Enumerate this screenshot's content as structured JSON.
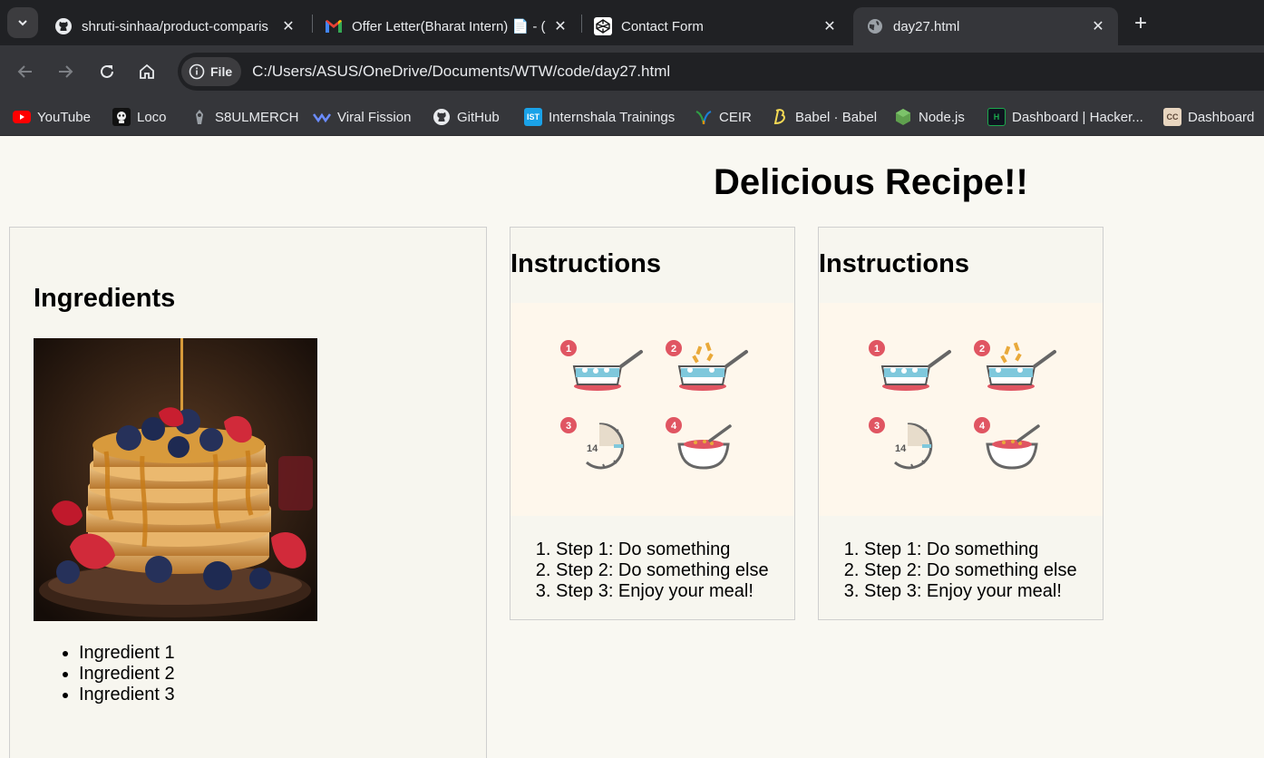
{
  "browser": {
    "tabs": [
      {
        "title": "shruti-sinhaa/product-comparis",
        "icon": "github-icon"
      },
      {
        "title": "Offer Letter(Bharat Intern) 📄 - (",
        "icon": "gmail-icon"
      },
      {
        "title": "Contact Form",
        "icon": "codepen-icon"
      },
      {
        "title": "day27.html",
        "icon": "globe-icon",
        "active": true
      }
    ],
    "address": {
      "chip_label": "File",
      "url": "C:/Users/ASUS/OneDrive/Documents/WTW/code/day27.html"
    },
    "bookmarks": [
      {
        "label": "YouTube",
        "icon": "youtube-icon"
      },
      {
        "label": "Loco",
        "icon": "loco-icon"
      },
      {
        "label": "S8ULMERCH",
        "icon": "s8ul-icon"
      },
      {
        "label": "Viral Fission",
        "icon": "viral-fission-icon"
      },
      {
        "label": "GitHub",
        "icon": "github-icon"
      },
      {
        "label": "Internshala Trainings",
        "icon": "internshala-icon",
        "badge": "IST"
      },
      {
        "label": "CEIR",
        "icon": "ceir-icon"
      },
      {
        "label": "Babel · Babel",
        "icon": "babel-icon"
      },
      {
        "label": "Node.js",
        "icon": "nodejs-icon"
      },
      {
        "label": "Dashboard | Hacker...",
        "icon": "hackerrank-icon",
        "badge": "H"
      },
      {
        "label": "Dashboard",
        "icon": "codechef-icon",
        "badge": "CC"
      }
    ]
  },
  "page": {
    "title": "Delicious Recipe!!",
    "ingredients": {
      "heading": "Ingredients",
      "items": [
        "Ingredient 1",
        "Ingredient 2",
        "Ingredient 3"
      ]
    },
    "instructions": [
      {
        "heading": "Instructions",
        "illustration_numbers": [
          "1",
          "2",
          "3",
          "4"
        ],
        "timer_label": "14",
        "steps": [
          "Step 1: Do something",
          "Step 2: Do something else",
          "Step 3: Enjoy your meal!"
        ]
      },
      {
        "heading": "Instructions",
        "illustration_numbers": [
          "1",
          "2",
          "3",
          "4"
        ],
        "timer_label": "14",
        "steps": [
          "Step 1: Do something",
          "Step 2: Do something else",
          "Step 3: Enjoy your meal!"
        ]
      }
    ]
  },
  "colors": {
    "chrome_dark": "#202124",
    "chrome_mid": "#35363a",
    "page_bg": "#f9f8f2",
    "step_badge": "#e05562"
  }
}
